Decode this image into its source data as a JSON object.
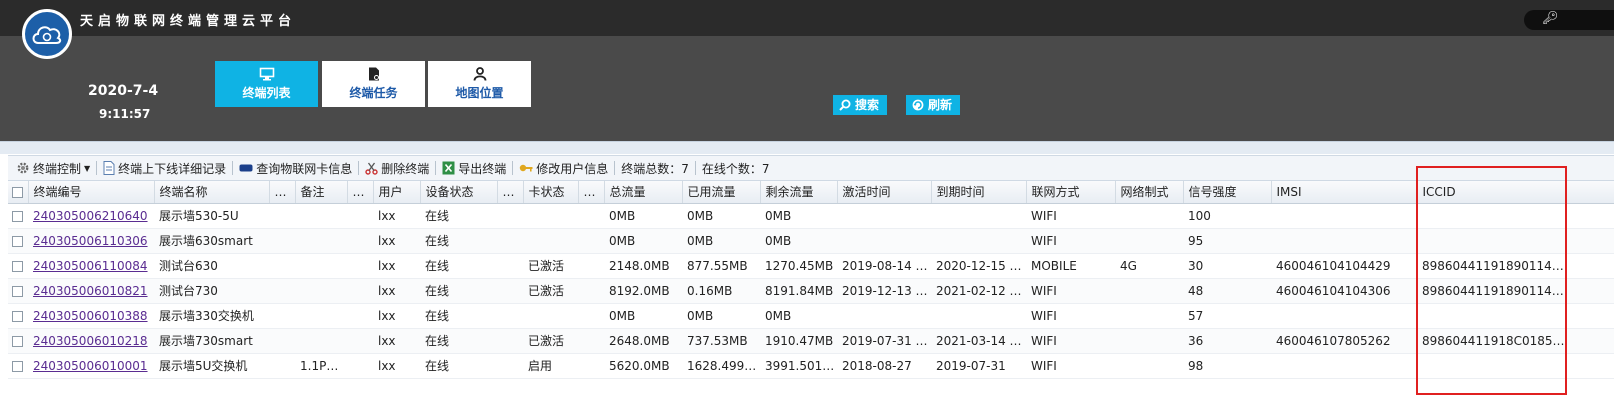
{
  "app": {
    "title": "天启物联网终端管理云平台"
  },
  "clock": {
    "date": "2020-7-4",
    "time": "9:11:57"
  },
  "nav": [
    {
      "label": "终端列表",
      "icon": "monitor-icon",
      "active": true
    },
    {
      "label": "终端任务",
      "icon": "document-icon",
      "active": false
    },
    {
      "label": "地图位置",
      "icon": "person-icon",
      "active": false
    }
  ],
  "actions": {
    "search": "搜索",
    "refresh": "刷新"
  },
  "toolbar": {
    "control": "终端控制",
    "online_log": "终端上下线详细记录",
    "sim_query": "查询物联网卡信息",
    "delete": "删除终端",
    "export": "导出终端",
    "edit_user": "修改用户信息",
    "total": "终端总数：7",
    "online": "在线个数：7"
  },
  "table": {
    "headers": [
      "终端编号",
      "终端名称",
      "…",
      "备注",
      "…",
      "用户",
      "设备状态",
      "…",
      "卡状态",
      "…",
      "总流量",
      "已用流量",
      "剩余流量",
      "激活时间",
      "到期时间",
      "联网方式",
      "网络制式",
      "信号强度",
      "IMSI",
      "ICCID"
    ],
    "rows": [
      [
        "240305006210640",
        "展示墙530-5U",
        "",
        "",
        "",
        "lxx",
        "在线",
        "",
        "",
        "",
        "0MB",
        "0MB",
        "0MB",
        "",
        "",
        "WIFI",
        "",
        "100",
        "",
        ""
      ],
      [
        "240305006110306",
        "展示墙630smart",
        "",
        "",
        "",
        "lxx",
        "在线",
        "",
        "",
        "",
        "0MB",
        "0MB",
        "0MB",
        "",
        "",
        "WIFI",
        "",
        "95",
        "",
        ""
      ],
      [
        "240305006110084",
        "测试台630",
        "",
        "",
        "",
        "lxx",
        "在线",
        "",
        "已激活",
        "",
        "2148.0MB",
        "877.55MB",
        "1270.45MB",
        "2019-08-14 …",
        "2020-12-15 …",
        "MOBILE",
        "4G",
        "30",
        "460046104104429",
        "89860441191890114…"
      ],
      [
        "240305006010821",
        "测试台730",
        "",
        "",
        "",
        "lxx",
        "在线",
        "",
        "已激活",
        "",
        "8192.0MB",
        "0.16MB",
        "8191.84MB",
        "2019-12-13 …",
        "2021-02-12 …",
        "WIFI",
        "",
        "48",
        "460046104104306",
        "89860441191890114…"
      ],
      [
        "240305006010388",
        "展示墙330交换机",
        "",
        "",
        "",
        "lxx",
        "在线",
        "",
        "",
        "",
        "0MB",
        "0MB",
        "0MB",
        "",
        "",
        "WIFI",
        "",
        "57",
        "",
        ""
      ],
      [
        "240305006010218",
        "展示墙730smart",
        "",
        "",
        "",
        "lxx",
        "在线",
        "",
        "已激活",
        "",
        "2648.0MB",
        "737.53MB",
        "1910.47MB",
        "2019-07-31 …",
        "2021-03-14 …",
        "WIFI",
        "",
        "36",
        "460046107805262",
        "898604411918C0185…"
      ],
      [
        "240305006010001",
        "展示墙5U交换机",
        "",
        "1.1P…",
        "",
        "lxx",
        "在线",
        "",
        "启用",
        "",
        "5620.0MB",
        "1628.499…",
        "3991.501…",
        "2018-08-27",
        "2019-07-31",
        "WIFI",
        "",
        "98",
        "",
        ""
      ]
    ]
  },
  "colors": {
    "accent": "#0fb3e4",
    "header": "#4a4a4a",
    "topbar": "#2b2b2b",
    "link": "#5a2c91",
    "highlight": "#e02020"
  }
}
